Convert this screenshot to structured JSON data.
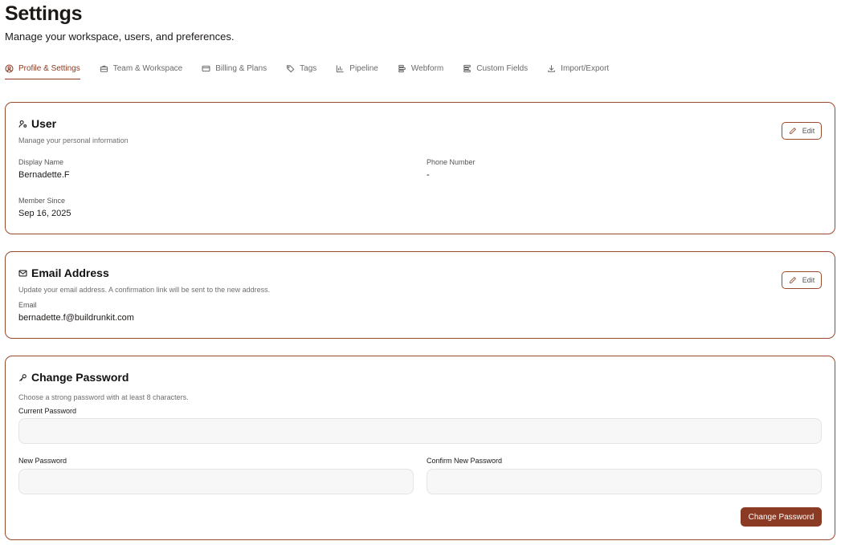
{
  "header": {
    "title": "Settings",
    "subtitle": "Manage your workspace, users, and preferences."
  },
  "tabs": [
    {
      "label": "Profile & Settings",
      "icon": "user-circle-icon",
      "active": true
    },
    {
      "label": "Team & Workspace",
      "icon": "briefcase-icon",
      "active": false
    },
    {
      "label": "Billing & Plans",
      "icon": "credit-card-icon",
      "active": false
    },
    {
      "label": "Tags",
      "icon": "tag-icon",
      "active": false
    },
    {
      "label": "Pipeline",
      "icon": "chart-icon",
      "active": false
    },
    {
      "label": "Webform",
      "icon": "form-icon",
      "active": false
    },
    {
      "label": "Custom Fields",
      "icon": "list-icon",
      "active": false
    },
    {
      "label": "Import/Export",
      "icon": "download-icon",
      "active": false
    }
  ],
  "user_card": {
    "title": "User",
    "description": "Manage your personal information",
    "edit_label": "Edit",
    "display_name_label": "Display Name",
    "display_name": "Bernadette.F",
    "phone_label": "Phone Number",
    "phone": "-",
    "member_since_label": "Member Since",
    "member_since": "Sep 16, 2025"
  },
  "email_card": {
    "title": "Email Address",
    "description": "Update your email address. A confirmation link will be sent to the new address.",
    "edit_label": "Edit",
    "email_label": "Email",
    "email": "bernadette.f@buildrunkit.com"
  },
  "password_card": {
    "title": "Change Password",
    "description": "Choose a strong password with at least 8 characters.",
    "current_label": "Current Password",
    "current_value": "",
    "new_label": "New Password",
    "new_value": "",
    "confirm_label": "Confirm New Password",
    "confirm_value": "",
    "submit_label": "Change Password"
  },
  "colors": {
    "accent": "#8b3a23",
    "card_border": "#9a4a2c",
    "input_bg": "#f7f7f7"
  }
}
